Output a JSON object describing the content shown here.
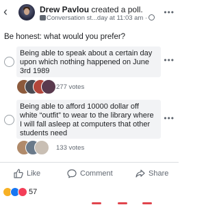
{
  "header": {
    "back_icon": "chevron-left-icon",
    "author": "Drew Pavlou",
    "action": " created a poll.",
    "group": "Conversation st...",
    "time": "day at 11:03 am",
    "separator": "·"
  },
  "question": "Be honest: what would you prefer?",
  "poll": {
    "options": [
      {
        "text": "Being able to speak about a certain day upon which nothing happened on June 3rd 1989",
        "votes": "277 votes"
      },
      {
        "text": "Being able to afford 10000 dollar off white “outfit” to wear to the library where I will fall asleep at computers that other students need",
        "votes": "133 votes"
      }
    ]
  },
  "actions": {
    "like": "Like",
    "comment": "Comment",
    "share": "Share"
  },
  "reactions": {
    "icons": [
      "haha-icon",
      "like-icon",
      "love-icon"
    ],
    "count": "57"
  },
  "colors": {
    "like_blue": "#1877f2",
    "love_red": "#f33e58",
    "haha_yellow": "#f7b125"
  }
}
